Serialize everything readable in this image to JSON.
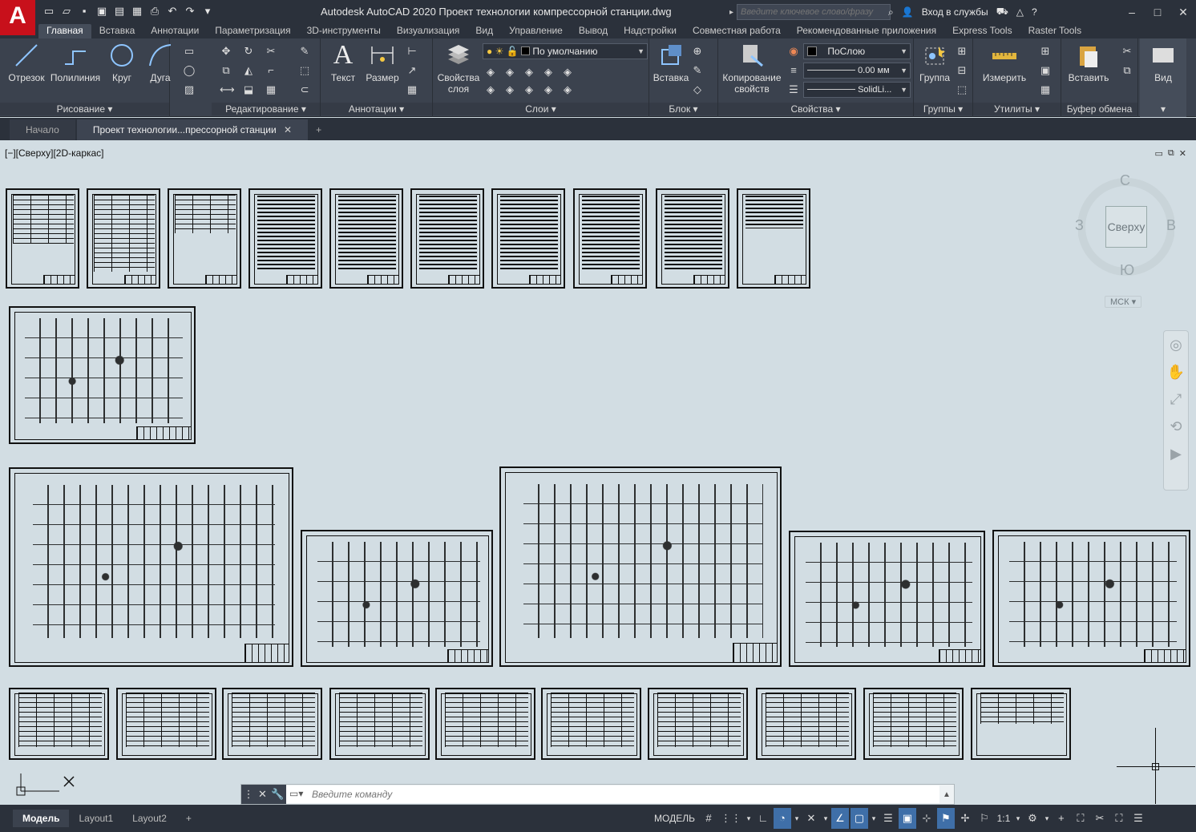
{
  "app": {
    "logo": "A",
    "title": "Autodesk AutoCAD 2020   Проект технологии компрессорной станции.dwg",
    "search_placeholder": "Введите ключевое слово/фразу",
    "signin": "Вход в службы",
    "help": "?"
  },
  "ribbon_tabs": [
    "Главная",
    "Вставка",
    "Аннотации",
    "Параметризация",
    "3D-инструменты",
    "Визуализация",
    "Вид",
    "Управление",
    "Вывод",
    "Надстройки",
    "Совместная работа",
    "Рекомендованные приложения",
    "Express Tools",
    "Raster Tools"
  ],
  "panels": {
    "draw": {
      "title": "Рисование",
      "line": "Отрезок",
      "pline": "Полилиния",
      "circle": "Круг",
      "arc": "Дуга"
    },
    "modify": {
      "title": "Редактирование"
    },
    "annot": {
      "title": "Аннотации",
      "text": "Текст",
      "dim": "Размер"
    },
    "layers": {
      "title": "Слои",
      "props": "Свойства",
      "props2": "слоя",
      "current": "По умолчанию"
    },
    "block": {
      "title": "Блок",
      "insert": "Вставка"
    },
    "props": {
      "title": "Свойства",
      "match": "Копирование",
      "match2": "свойств",
      "color": "ПоСлою",
      "lineweight": "0.00 мм",
      "linetype": "SolidLi..."
    },
    "groups": {
      "title": "Группы",
      "group": "Группа"
    },
    "utils": {
      "title": "Утилиты",
      "measure": "Измерить"
    },
    "clip": {
      "title": "Буфер обмена",
      "paste": "Вставить"
    },
    "view": {
      "title": "Вид"
    }
  },
  "doc_tabs": [
    "Начало",
    "Проект технологии...прессорной станции"
  ],
  "viewport_label": "[−][Сверху][2D-каркас]",
  "viewcube": {
    "face": "Сверху",
    "n": "С",
    "s": "Ю",
    "w": "З",
    "e": "В",
    "ucs": "МСК"
  },
  "command_placeholder": "Введите команду",
  "layout_tabs": [
    "Модель",
    "Layout1",
    "Layout2",
    "+"
  ],
  "status": {
    "model": "МОДЕЛЬ",
    "scale": "1:1"
  }
}
